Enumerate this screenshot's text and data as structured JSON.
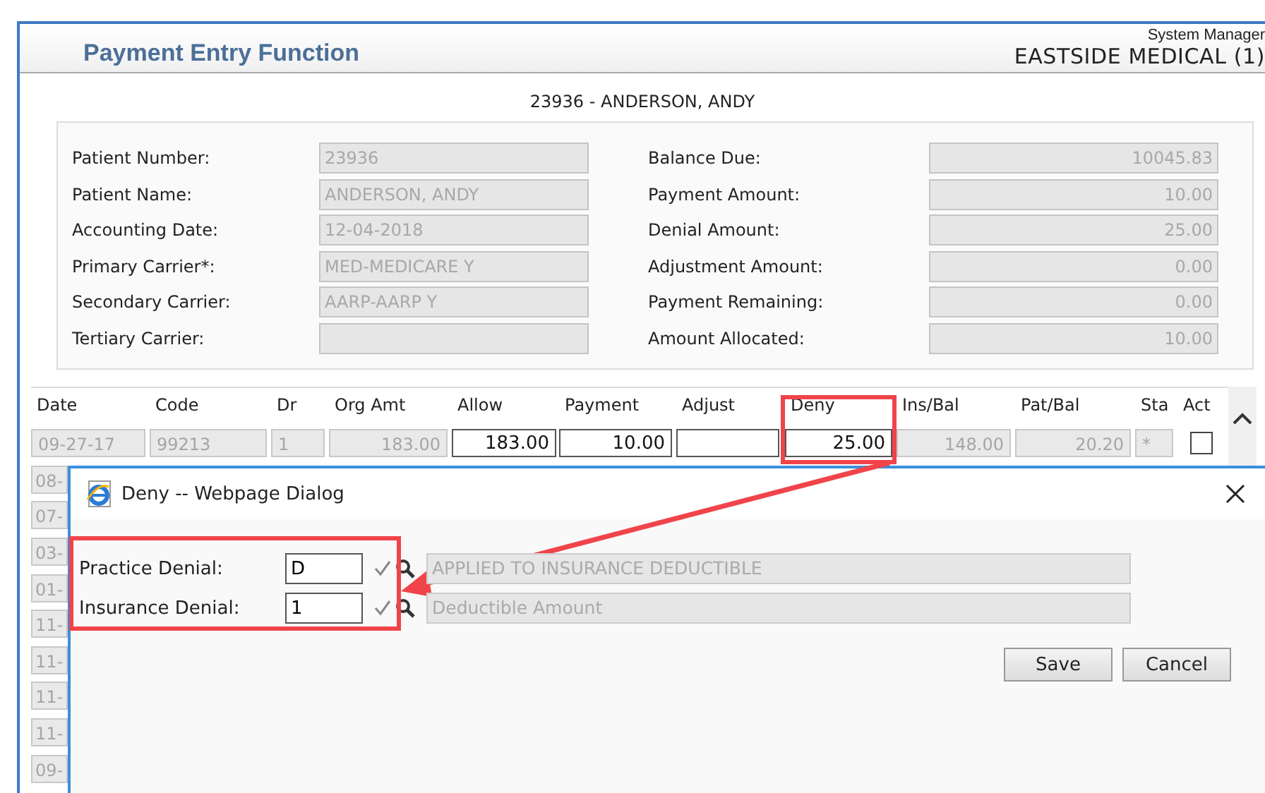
{
  "header": {
    "title": "Payment Entry Function",
    "user": "System Manager",
    "practice": "EASTSIDE MEDICAL (1)"
  },
  "patient_line": "23936 - ANDERSON, ANDY",
  "patient_info": {
    "left": [
      {
        "label": "Patient Number:",
        "value": "23936"
      },
      {
        "label": "Patient Name:",
        "value": "ANDERSON, ANDY"
      },
      {
        "label": "Accounting Date:",
        "value": "12-04-2018"
      },
      {
        "label": "Primary Carrier*:",
        "value": "MED-MEDICARE Y"
      },
      {
        "label": "Secondary Carrier:",
        "value": "AARP-AARP Y"
      },
      {
        "label": "Tertiary Carrier:"
      }
    ],
    "right": [
      {
        "label": "Balance Due:",
        "value": "10045.83"
      },
      {
        "label": "Payment Amount:",
        "value": "10.00"
      },
      {
        "label": "Denial Amount:",
        "value": "25.00"
      },
      {
        "label": "Adjustment Amount:",
        "value": "0.00"
      },
      {
        "label": "Payment Remaining:",
        "value": "0.00"
      },
      {
        "label": "Amount Allocated:",
        "value": "10.00"
      }
    ]
  },
  "table": {
    "columns": [
      "Date",
      "Code",
      "Dr",
      "Org Amt",
      "Allow",
      "Payment",
      "Adjust",
      "Deny",
      "Ins/Bal",
      "Pat/Bal",
      "Sta",
      "Act"
    ],
    "first_row": {
      "cells": [
        {
          "value": "09-27-17",
          "editable": false
        },
        {
          "value": "99213",
          "editable": false
        },
        {
          "value": "1",
          "editable": false
        },
        {
          "value": "183.00",
          "editable": false
        },
        {
          "value": "183.00",
          "editable": true
        },
        {
          "value": "10.00",
          "editable": true
        },
        {
          "editable": true
        },
        {
          "value": "25.00",
          "editable": true
        },
        {
          "value": "148.00",
          "editable": false
        },
        {
          "value": "20.20",
          "editable": false
        },
        {
          "value": "*",
          "editable": false
        }
      ],
      "act_checked": false
    },
    "other_rows_dates": [
      "08-",
      "07-",
      "03-",
      "01-",
      "11-",
      "11-",
      "11-",
      "11-",
      "09-"
    ]
  },
  "dialog": {
    "title": "Deny -- Webpage Dialog",
    "fields": [
      {
        "label": "Practice Denial:",
        "value": "D",
        "description": "APPLIED TO INSURANCE DEDUCTIBLE"
      },
      {
        "label": "Insurance Denial:",
        "value": "1",
        "description": "Deductible Amount"
      }
    ],
    "buttons": [
      "Save",
      "Cancel"
    ]
  }
}
